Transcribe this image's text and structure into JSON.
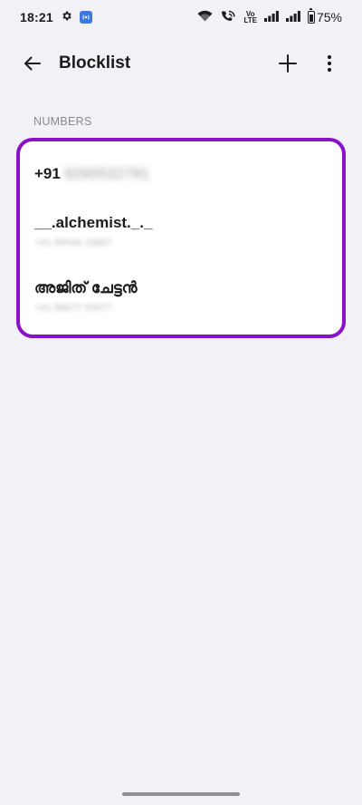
{
  "status_bar": {
    "time": "18:21",
    "battery_percent": "75%",
    "volte_top": "Vo",
    "volte_bottom": "LTE",
    "icons": [
      "gear-icon",
      "nfc-icon",
      "wifi-icon",
      "wifi-calling-icon",
      "volte-icon",
      "signal-icon",
      "signal-icon",
      "battery-icon"
    ]
  },
  "app_bar": {
    "title": "Blocklist",
    "back_icon": "arrow-left-icon",
    "add_icon": "plus-icon",
    "more_icon": "more-vertical-icon"
  },
  "section": {
    "label": "NUMBERS"
  },
  "blocklist": [
    {
      "name": "+91",
      "blurred_number": "9260532781",
      "subtitle": ""
    },
    {
      "name": "__.alchemist._._",
      "blurred_number": "",
      "subtitle": "+91 95548 19687"
    },
    {
      "name": "അജിത് ചേട്ടൻ",
      "blurred_number": "",
      "subtitle": "+91 98477 55677"
    }
  ],
  "colors": {
    "background": "#f2f1f5",
    "card": "#ffffff",
    "highlight_border": "#8a10c9",
    "nfc_badge": "#3e76e3"
  }
}
